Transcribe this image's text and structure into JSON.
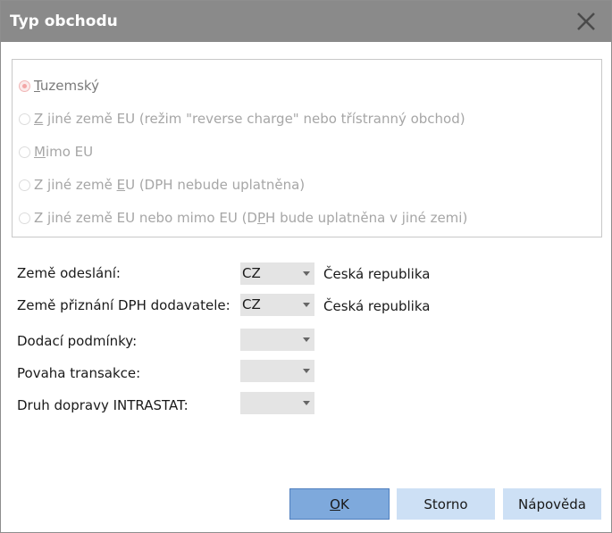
{
  "dialog": {
    "title": "Typ obchodu"
  },
  "trade_type": {
    "options": [
      {
        "pre": "",
        "ul": "T",
        "post": "uzemský",
        "checked": true
      },
      {
        "pre": "",
        "ul": "Z",
        "post": " jiné země EU (režim \"reverse charge\" nebo třístranný obchod)",
        "checked": false
      },
      {
        "pre": "",
        "ul": "M",
        "post": "imo EU",
        "checked": false
      },
      {
        "pre": "Z jiné země ",
        "ul": "E",
        "post": "U (DPH nebude uplatněna)",
        "checked": false
      },
      {
        "pre": "Z jiné země EU nebo mimo EU (D",
        "ul": "P",
        "post": "H bude uplatněna v jiné zemi)",
        "checked": false
      }
    ]
  },
  "fields": {
    "dispatch_country": {
      "label": "Země odeslání:",
      "value": "CZ",
      "name": "Česká republika"
    },
    "vat_country": {
      "label": "Země přiznání DPH dodavatele:",
      "value": "CZ",
      "name": "Česká republika"
    },
    "delivery_terms": {
      "label": "Dodací podmínky:",
      "value": ""
    },
    "transaction_nature": {
      "label": "Povaha transakce:",
      "value": ""
    },
    "transport_mode": {
      "label": "Druh dopravy INTRASTAT:",
      "value": ""
    }
  },
  "buttons": {
    "ok": {
      "ul": "O",
      "post": "K"
    },
    "cancel": "Storno",
    "help": "Nápověda"
  },
  "colors": {
    "titlebar": "#8a8a8a",
    "ok_button": "#7ea9dc",
    "secondary_button": "#cde0f5",
    "combo_bg": "#e4e4e4"
  }
}
